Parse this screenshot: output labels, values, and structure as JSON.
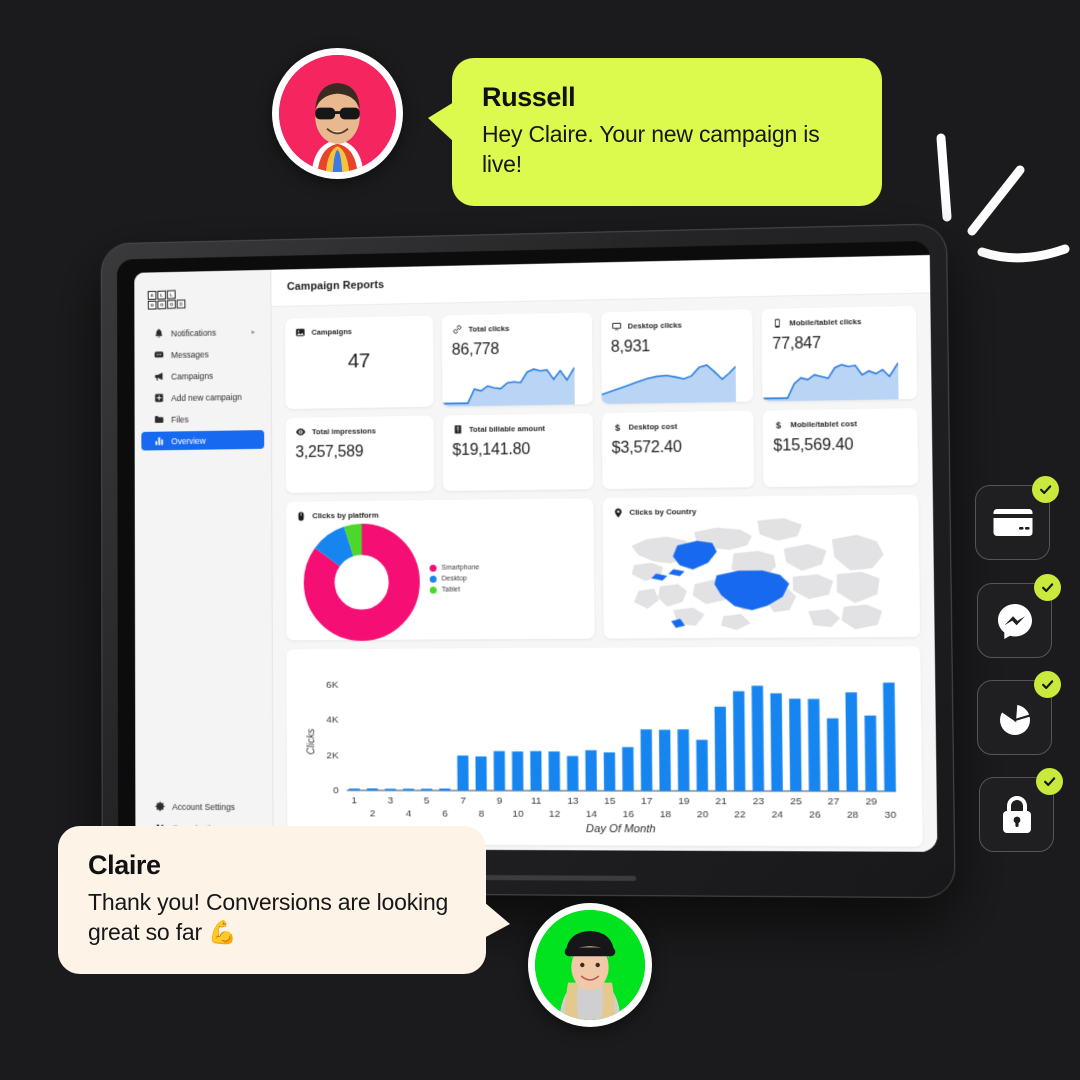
{
  "background_color": "#1b1b1d",
  "brand": {
    "logo_name": "all-good-logo",
    "tiles_top": [
      "A",
      "L",
      "L"
    ],
    "tiles_bottom": [
      "G",
      "O",
      "O",
      "D"
    ]
  },
  "sidebar": {
    "items": [
      {
        "label": "Notifications",
        "icon": "bell-icon",
        "has_submenu": true,
        "active": false
      },
      {
        "label": "Messages",
        "icon": "chat-icon",
        "has_submenu": false,
        "active": false
      },
      {
        "label": "Campaigns",
        "icon": "megaphone-icon",
        "has_submenu": false,
        "active": false
      },
      {
        "label": "Add new campaign",
        "icon": "add-box-icon",
        "has_submenu": false,
        "active": false
      },
      {
        "label": "Files",
        "icon": "folder-icon",
        "has_submenu": false,
        "active": false
      },
      {
        "label": "Overview",
        "icon": "bar-chart-icon",
        "has_submenu": false,
        "active": true
      }
    ],
    "footer_items": [
      {
        "label": "Account Settings",
        "icon": "gear-icon"
      },
      {
        "label": "Organization",
        "icon": "people-icon"
      }
    ],
    "active_color": "#1769f0",
    "caret_glyph": "▸"
  },
  "header": {
    "title": "Campaign Reports"
  },
  "kpis_row1": [
    {
      "label": "Campaigns",
      "value": "47",
      "icon": "image-icon",
      "has_sparkline": false
    },
    {
      "label": "Total clicks",
      "value": "86,778",
      "icon": "link-icon",
      "has_sparkline": true
    },
    {
      "label": "Desktop clicks",
      "value": "8,931",
      "icon": "monitor-icon",
      "has_sparkline": true
    },
    {
      "label": "Mobile/tablet clicks",
      "value": "77,847",
      "icon": "phone-icon",
      "has_sparkline": true
    }
  ],
  "kpis_row2": [
    {
      "label": "Total impressions",
      "value": "3,257,589",
      "icon": "eye-icon"
    },
    {
      "label": "Total billable amount",
      "value": "$19,141.80",
      "icon": "receipt-icon"
    },
    {
      "label": "Desktop cost",
      "value": "$3,572.40",
      "icon": "dollar-icon"
    },
    {
      "label": "Mobile/tablet cost",
      "value": "$15,569.40",
      "icon": "dollar-icon"
    }
  ],
  "panels": {
    "donut_title": "Clicks by platform",
    "donut_icon": "mouse-icon",
    "map_title": "Clicks by Country",
    "map_icon": "map-pin-icon",
    "map_highlight_color": "#1769f0",
    "map_base_color": "#e0e0e2"
  },
  "chart_data": [
    {
      "type": "pie",
      "title": "Clicks by platform",
      "labels": [
        "Smartphone",
        "Desktop",
        "Tablet"
      ],
      "values": [
        85,
        10,
        5
      ],
      "colors": [
        "#f50e73",
        "#1785f0",
        "#4cd82b"
      ],
      "legend_position": "right",
      "donut": true
    },
    {
      "type": "bar",
      "title": "",
      "xlabel": "Day Of Month",
      "ylabel": "Clicks",
      "categories": [
        "1",
        "2",
        "3",
        "4",
        "5",
        "6",
        "7",
        "8",
        "9",
        "10",
        "11",
        "12",
        "13",
        "14",
        "15",
        "16",
        "17",
        "18",
        "19",
        "20",
        "21",
        "22",
        "23",
        "24",
        "25",
        "26",
        "27",
        "28",
        "29",
        "30"
      ],
      "values": [
        100,
        110,
        95,
        100,
        100,
        110,
        1950,
        1900,
        2200,
        2180,
        2200,
        2180,
        1930,
        2250,
        2130,
        2420,
        3400,
        3380,
        3400,
        2820,
        4650,
        5500,
        5800,
        5380,
        5080,
        5060,
        4000,
        5420,
        4150,
        5950
      ],
      "ylim": [
        0,
        6500
      ],
      "yticks": [
        "0",
        "2K",
        "4K",
        "6K"
      ],
      "bar_color": "#1785f0",
      "grid": false
    },
    {
      "type": "line",
      "title": "Total clicks sparkline",
      "values": [
        4,
        4,
        4,
        4,
        20,
        26,
        24,
        30,
        28,
        27,
        33,
        34,
        33,
        52,
        58,
        55,
        57,
        44,
        60,
        38,
        66
      ],
      "color": "#2d7fe0",
      "fill_color": "#b9d4f5"
    },
    {
      "type": "line",
      "title": "Desktop clicks sparkline",
      "values": [
        12,
        18,
        24,
        30,
        36,
        40,
        42,
        40,
        38,
        42,
        62,
        72,
        58,
        40,
        52,
        68
      ],
      "color": "#2d7fe0",
      "fill_color": "#b9d4f5"
    },
    {
      "type": "line",
      "title": "Mobile/tablet clicks sparkline",
      "values": [
        4,
        4,
        4,
        4,
        20,
        30,
        28,
        34,
        32,
        30,
        48,
        56,
        54,
        56,
        40,
        48,
        42,
        52,
        36,
        60
      ],
      "color": "#2d7fe0",
      "fill_color": "#b9d4f5"
    }
  ],
  "chat": {
    "messages": [
      {
        "name": "Russell",
        "text": "Hey Claire. Your new campaign is live!",
        "bubble_color": "#dcf94d",
        "avatar_name": "avatar-russell",
        "avatar_bg": "#f5255f",
        "side": "left"
      },
      {
        "name": "Claire",
        "text": "Thank you! Conversions are looking great so far 💪",
        "bubble_color": "#fdf3e6",
        "avatar_name": "avatar-claire",
        "avatar_bg": "#00e31e",
        "side": "right"
      }
    ]
  },
  "badge_tiles": [
    {
      "icon": "credit-card-icon",
      "checked": true
    },
    {
      "icon": "messenger-icon",
      "checked": true
    },
    {
      "icon": "pie-chart-icon",
      "checked": true
    },
    {
      "icon": "lock-icon",
      "checked": true
    }
  ],
  "badge_check_color": "#c9e93d",
  "decor": {
    "name": "decorative-strokes",
    "color": "#ffffff",
    "count": 3
  }
}
